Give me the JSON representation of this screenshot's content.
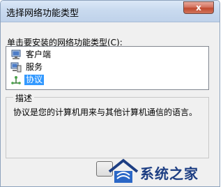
{
  "window": {
    "title": "选择网络功能类型",
    "close_glyph": "x"
  },
  "dialog": {
    "instruction": "单击要安装的网络功能类型(C):",
    "items": [
      {
        "label": "客户端",
        "icon": "client-computer-icon",
        "selected": false
      },
      {
        "label": "服务",
        "icon": "service-icon",
        "selected": false
      },
      {
        "label": "协议",
        "icon": "protocol-icon",
        "selected": true
      }
    ],
    "description_title": "描述",
    "description_text": "协议是您的计算机用来与其他计算机通信的语言。"
  },
  "watermark": {
    "text": "系统之家"
  },
  "colors": {
    "selection": "#3399ff",
    "window_bg": "#f0f0f0",
    "watermark_blue": "#1d3e83"
  }
}
